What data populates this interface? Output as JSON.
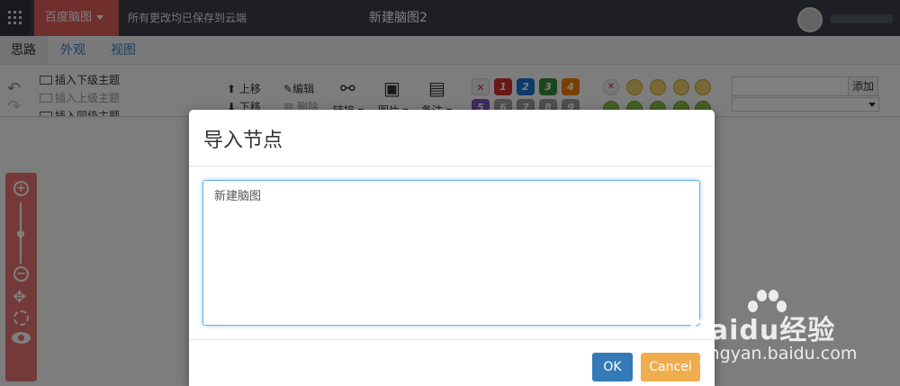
{
  "topbar": {
    "app_name": "百度脑图",
    "save_status": "所有更改均已保存到云端",
    "doc_title": "新建脑图2"
  },
  "menu_tabs": [
    "思路",
    "外观",
    "视图"
  ],
  "ribbon": {
    "insert_child": "插入下级主题",
    "insert_parent": "插入上级主题",
    "insert_sibling": "插入同级主题",
    "move_up": "上移",
    "move_down": "下移",
    "edit": "编辑",
    "delete": "删除",
    "link": "链接",
    "image": "图片",
    "note": "备注",
    "priority": [
      "1",
      "2",
      "3",
      "4",
      "5",
      "6",
      "7",
      "8",
      "9"
    ],
    "tag_add": "添加"
  },
  "colors": {
    "accent_red": "#e05c5b",
    "topbar": "#3a3f4a",
    "ok_button": "#337ab7",
    "cancel_button": "#f0ad4e",
    "priority": [
      "#d32f2f",
      "#1976d2",
      "#388e3c",
      "#f57c00",
      "#7e57c2",
      "#9e9e9e",
      "#9e9e9e",
      "#9e9e9e",
      "#9e9e9e"
    ]
  },
  "dialog": {
    "title": "导入节点",
    "textarea_value": "新建脑图",
    "ok_label": "OK",
    "cancel_label": "Cancel"
  },
  "watermark": {
    "brand": "Baidu经验",
    "url": "jingyan.baidu.com"
  }
}
